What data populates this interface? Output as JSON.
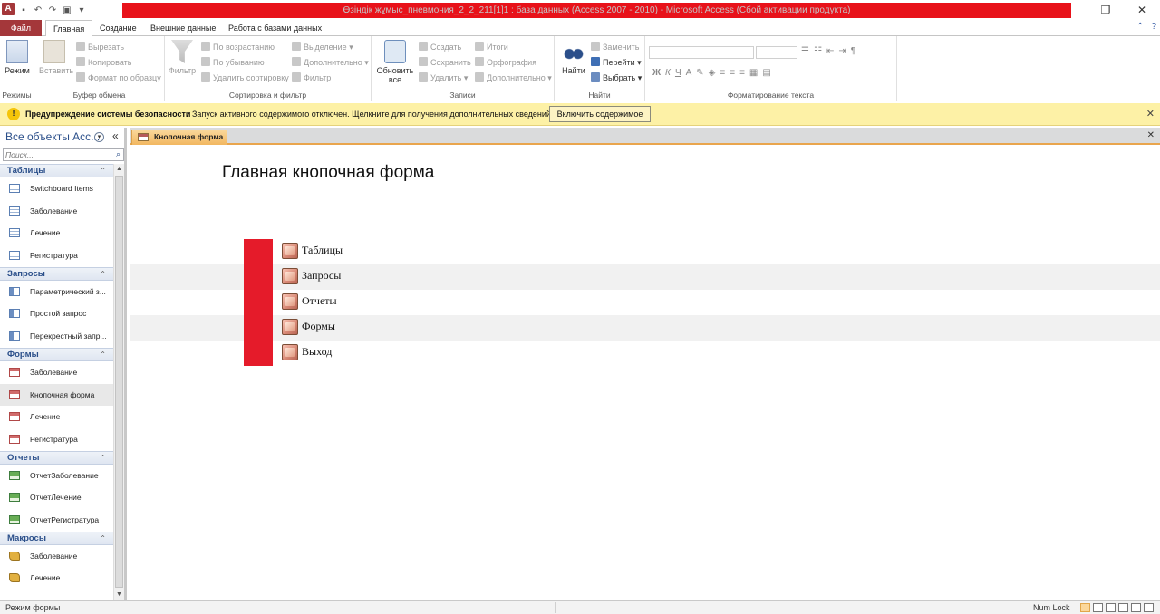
{
  "window": {
    "title": "Өзіндік жұмыс_пневмония_2_2_211[1]1 : база данных (Access 2007 - 2010) - Microsoft Access (Сбой активации продукта)",
    "app_icon_letter": "A"
  },
  "ribbon_tabs": [
    "Файл",
    "Главная",
    "Создание",
    "Внешние данные",
    "Работа с базами данных"
  ],
  "ribbon": {
    "groups": {
      "views": "Режимы",
      "clipboard": "Буфер обмена",
      "sort_filter": "Сортировка и фильтр",
      "records": "Записи",
      "find": "Найти",
      "text_format": "Форматирование текста"
    },
    "view_button": "Режим",
    "paste_button": "Вставить",
    "cut": "Вырезать",
    "copy": "Копировать",
    "format_painter": "Формат по образцу",
    "filter_button": "Фильтр",
    "ascending": "По возрастанию",
    "descending": "По убыванию",
    "remove_sort": "Удалить сортировку",
    "selection": "Выделение",
    "advanced": "Дополнительно",
    "toggle_filter": "Фильтр",
    "refresh_line1": "Обновить",
    "refresh_line2": "все",
    "new": "Создать",
    "save": "Сохранить",
    "delete": "Удалить",
    "totals": "Итоги",
    "spelling": "Орфография",
    "more": "Дополнительно",
    "find_button": "Найти",
    "replace": "Заменить",
    "goto": "Перейти",
    "select": "Выбрать"
  },
  "security_bar": {
    "heading": "Предупреждение системы безопасности",
    "message": "Запуск активного содержимого отключен. Щелкните для получения дополнительных сведений.",
    "enable_button": "Включить содержимое"
  },
  "nav_pane": {
    "title": "Все объекты Acc...",
    "search_placeholder": "Поиск...",
    "sections": [
      {
        "label": "Таблицы",
        "icon": "table-icon",
        "items": [
          "Switchboard Items",
          "Заболевание",
          "Лечение",
          "Регистратура"
        ]
      },
      {
        "label": "Запросы",
        "icon": "query-icon",
        "items": [
          "Параметрический з...",
          "Простой запрос",
          "Перекрестный запр..."
        ]
      },
      {
        "label": "Формы",
        "icon": "form-icon",
        "items": [
          "Заболевание",
          "Кнопочная форма",
          "Лечение",
          "Регистратура"
        ]
      },
      {
        "label": "Отчеты",
        "icon": "report-icon",
        "items": [
          "ОтчетЗаболевание",
          "ОтчетЛечение",
          "ОтчетРегистратура"
        ]
      },
      {
        "label": "Макросы",
        "icon": "macro-icon",
        "items": [
          "Заболевание",
          "Лечение"
        ]
      }
    ],
    "selected_item": "Кнопочная форма"
  },
  "document": {
    "tab_label": "Кнопочная форма",
    "form_title": "Главная кнопочная форма",
    "menu_items": [
      "Таблицы",
      "Запросы",
      "Отчеты",
      "Формы",
      "Выход"
    ]
  },
  "status_bar": {
    "mode": "Режим формы",
    "num_lock": "Num Lock"
  },
  "colors": {
    "title_highlight": "#e8121a",
    "file_tab": "#a4373a",
    "security_bar": "#fdf1a6",
    "switchboard_column": "#e51b2a",
    "active_doc_tab": "#f2b760"
  }
}
